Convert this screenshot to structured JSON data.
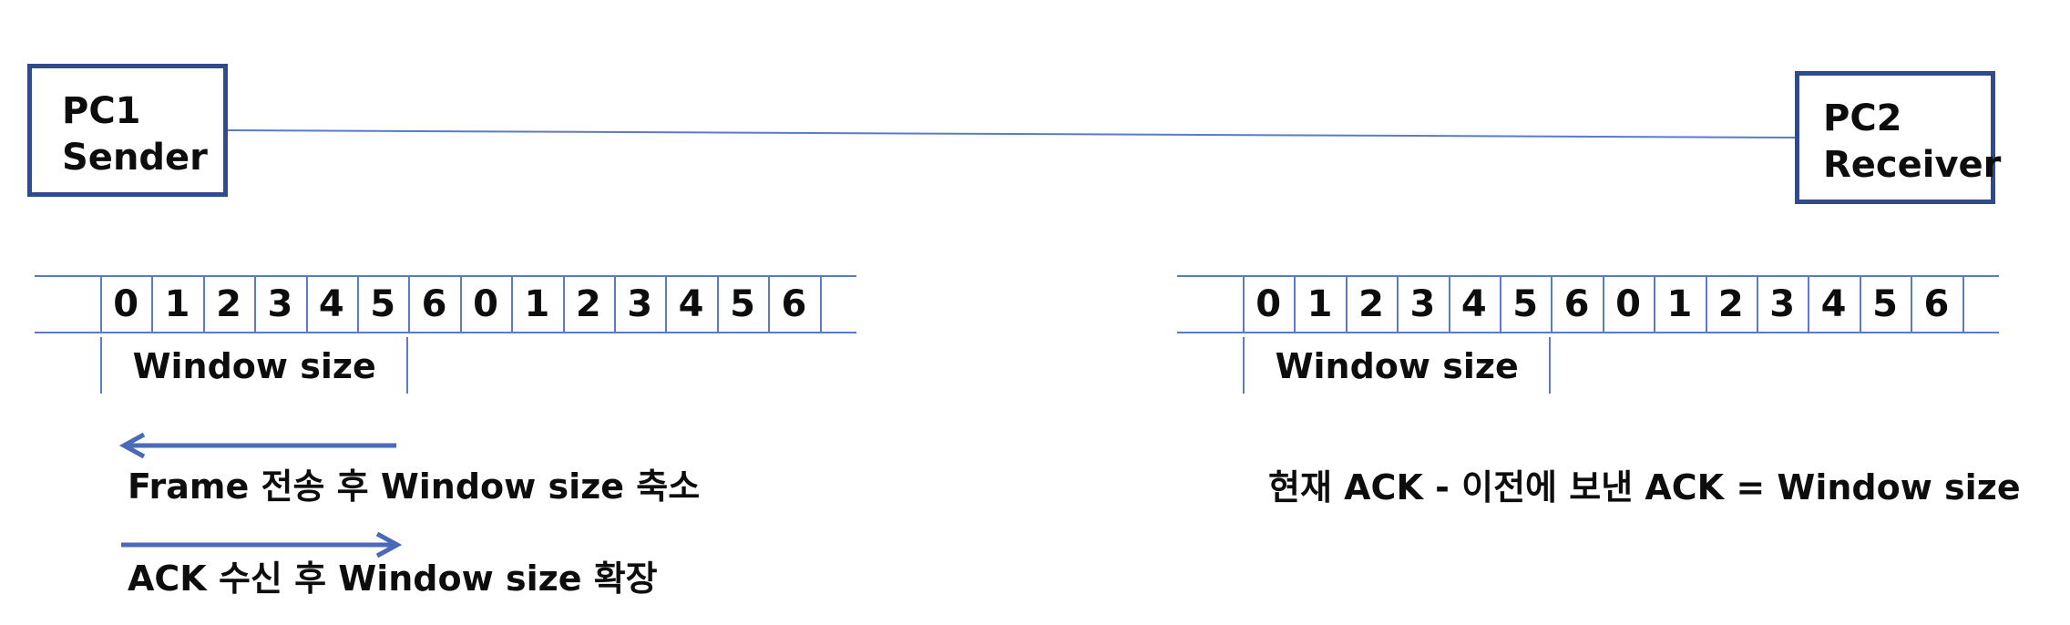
{
  "sender": {
    "line1": "PC1",
    "line2": "Sender"
  },
  "receiver": {
    "line1": "PC2",
    "line2": "Receiver"
  },
  "sender_sequence": [
    "0",
    "1",
    "2",
    "3",
    "4",
    "5",
    "6",
    "0",
    "1",
    "2",
    "3",
    "4",
    "5",
    "6"
  ],
  "receiver_sequence": [
    "0",
    "1",
    "2",
    "3",
    "4",
    "5",
    "6",
    "0",
    "1",
    "2",
    "3",
    "4",
    "5",
    "6"
  ],
  "sender_window": {
    "label": "Window size",
    "cells_covered": 6
  },
  "receiver_window": {
    "label": "Window size",
    "cells_covered": 6
  },
  "captions": {
    "shrink": "Frame 전송 후 Window size 축소",
    "expand": "ACK 수신 후 Window size 확장",
    "formula": "현재 ACK - 이전에 보낸 ACK = Window size"
  },
  "colors": {
    "box_border": "#2f4b8c",
    "line": "#5b7bc8",
    "arrow": "#4a69b8",
    "text": "#0d0d0d"
  },
  "arrows": [
    {
      "name": "shrink",
      "direction": "left"
    },
    {
      "name": "expand",
      "direction": "right"
    }
  ]
}
